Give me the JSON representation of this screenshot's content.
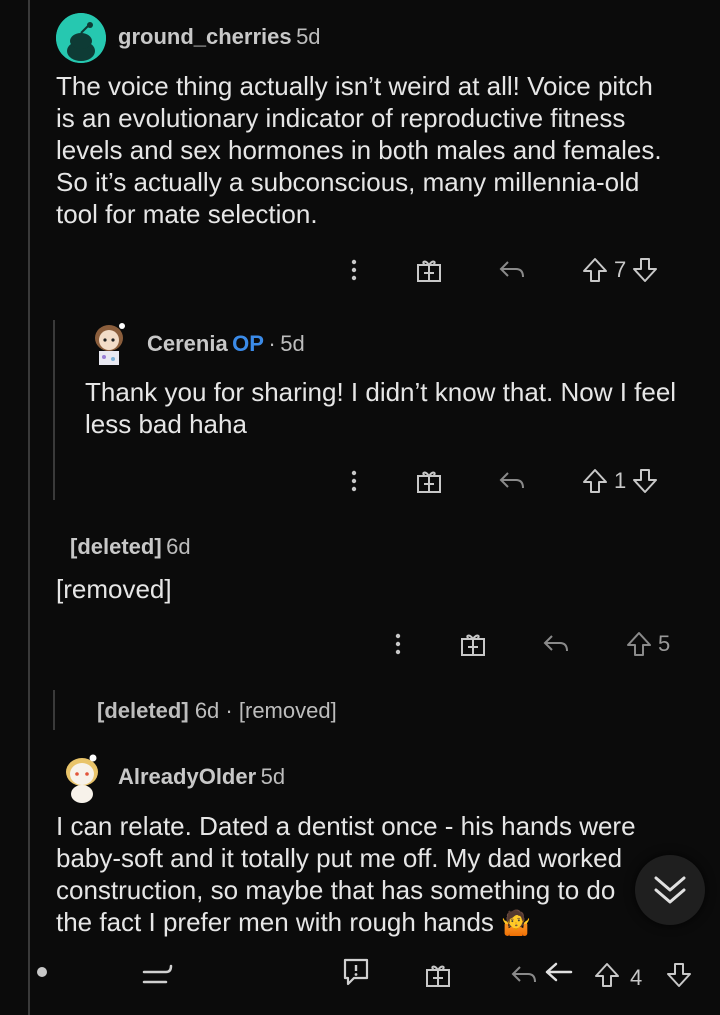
{
  "comments": [
    {
      "username": "ground_cherries",
      "age": "5d",
      "body_lines": [
        "The voice thing actually isn’t weird at all! Voice pitch",
        "is an evolutionary indicator of reproductive fitness",
        "levels and sex hormones in both males and females.",
        "So it’s actually a subconscious, many millennia-old",
        "tool for mate selection."
      ],
      "score": "7"
    },
    {
      "username": "Cerenia",
      "op_badge": "OP",
      "separator": "·",
      "age": "5d",
      "body_lines": [
        "Thank you for sharing! I didn’t know that. Now I feel",
        "less bad haha"
      ],
      "score": "1"
    },
    {
      "username": "[deleted]",
      "age": "6d",
      "body_lines": [
        "[removed]"
      ],
      "score": "5"
    },
    {
      "username": "[deleted]",
      "age": "6d",
      "separator": "·",
      "collapsed_body": "[removed]"
    },
    {
      "username": "AlreadyOlder",
      "age": "5d",
      "body_lines": [
        "I can relate.  Dated a dentist once - his hands were",
        "baby-soft and it totally put me off.  My dad worked",
        "construction, so maybe that has something to do",
        "the fact I prefer men with rough hands"
      ],
      "emoji": "🤷",
      "score": "4"
    }
  ],
  "icons": {
    "more": "more-vertical-icon",
    "award": "gift-award-icon",
    "reply": "reply-arrow-icon",
    "upvote": "upvote-arrow-icon",
    "downvote": "downvote-arrow-icon",
    "scroll_down": "chevron-double-down-icon",
    "collapse": "collapse-thread-icon",
    "comment": "comment-icon",
    "back": "back-arrow-icon"
  },
  "colors": {
    "background": "#0b0b0b",
    "op_badge": "#3b8be8",
    "avatar_teal": "#26c8b0"
  }
}
